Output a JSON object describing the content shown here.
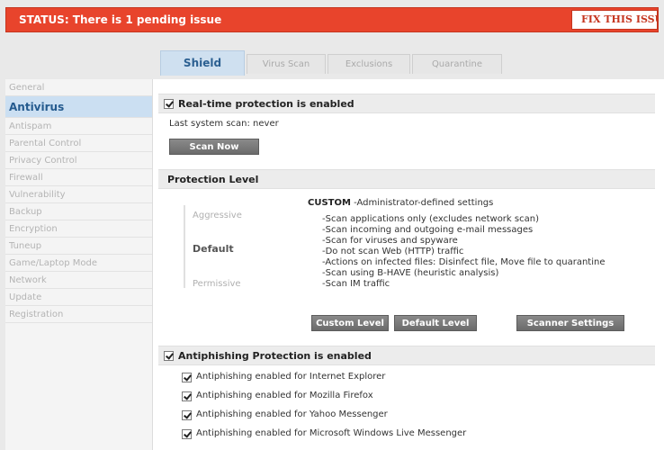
{
  "status": {
    "text": "STATUS: There is 1 pending issue",
    "fix_button": "FIX THIS ISSUE"
  },
  "tabs": [
    {
      "label": "Shield"
    },
    {
      "label": "Virus Scan"
    },
    {
      "label": "Exclusions"
    },
    {
      "label": "Quarantine"
    }
  ],
  "sidebar": {
    "items": [
      {
        "label": "General"
      },
      {
        "label": "Antivirus"
      },
      {
        "label": "Antispam"
      },
      {
        "label": "Parental Control"
      },
      {
        "label": "Privacy Control"
      },
      {
        "label": "Firewall"
      },
      {
        "label": "Vulnerability"
      },
      {
        "label": "Backup"
      },
      {
        "label": "Encryption"
      },
      {
        "label": "Tuneup"
      },
      {
        "label": "Game/Laptop Mode"
      },
      {
        "label": "Network"
      },
      {
        "label": "Update"
      },
      {
        "label": "Registration"
      }
    ],
    "active": "Antivirus"
  },
  "realtime": {
    "label": "Real-time protection is enabled",
    "checked": true,
    "last_scan": "Last system scan: never",
    "scan_now": "Scan Now"
  },
  "protection_level": {
    "title": "Protection Level",
    "levels": [
      "Aggressive",
      "Default",
      "Permissive"
    ],
    "selected": "Default",
    "custom_title": "CUSTOM",
    "custom_subtitle": " -Administrator-defined settings",
    "description": [
      "-Scan applications only (excludes network scan)",
      "-Scan incoming and outgoing e-mail messages",
      "-Scan for viruses and spyware",
      "-Do not scan Web (HTTP) traffic",
      "-Actions on infected files: Disinfect file, Move file to quarantine",
      "-Scan using B-HAVE (heuristic analysis)",
      "-Scan IM traffic"
    ],
    "buttons": {
      "custom_level": "Custom Level",
      "default_level": "Default Level",
      "scanner_settings": "Scanner Settings"
    }
  },
  "antiphishing": {
    "label": "Antiphishing Protection is enabled",
    "checked": true,
    "items": [
      {
        "label": "Antiphishing enabled for Internet Explorer",
        "checked": true
      },
      {
        "label": "Antiphishing enabled for Mozilla Firefox",
        "checked": true
      },
      {
        "label": "Antiphishing enabled for Yahoo Messenger",
        "checked": true
      },
      {
        "label": "Antiphishing enabled for Microsoft Windows Live Messenger",
        "checked": true
      }
    ]
  },
  "colors": {
    "status_red": "#e8442c",
    "accent_blue": "#2b5f91",
    "active_tab_bg": "#cfe0f0"
  }
}
